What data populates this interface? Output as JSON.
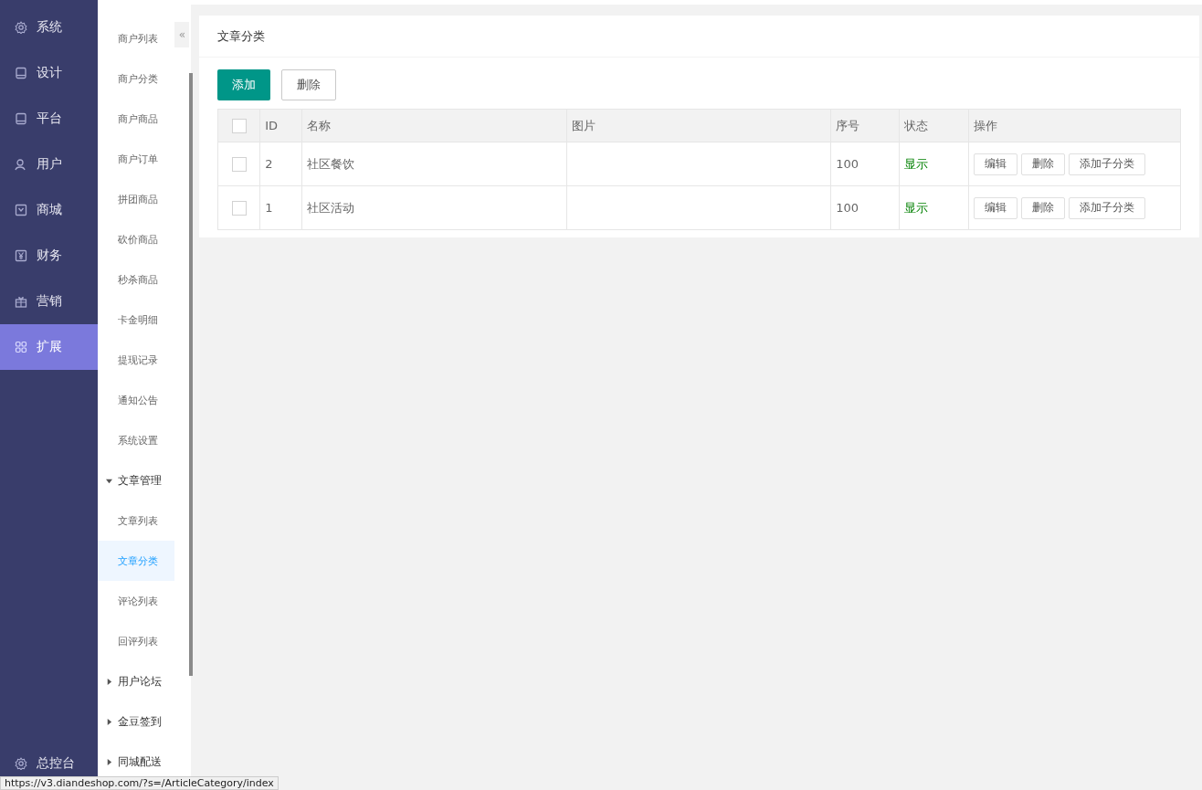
{
  "nav": {
    "items": [
      {
        "label": "系统",
        "kind": "gear",
        "selected": false
      },
      {
        "label": "设计",
        "kind": "tablet",
        "selected": false
      },
      {
        "label": "平台",
        "kind": "tablet",
        "selected": false
      },
      {
        "label": "用户",
        "kind": "users",
        "selected": false
      },
      {
        "label": "商城",
        "kind": "bag",
        "selected": false
      },
      {
        "label": "财务",
        "kind": "yen",
        "selected": false
      },
      {
        "label": "营销",
        "kind": "gift",
        "selected": false
      },
      {
        "label": "扩展",
        "kind": "grid",
        "selected": true
      }
    ],
    "footer": {
      "label": "总控台"
    }
  },
  "submenu": {
    "collapse_icon": "«",
    "items": [
      {
        "kind": "link",
        "label": "商户列表",
        "selected": false
      },
      {
        "kind": "link",
        "label": "商户分类",
        "selected": false
      },
      {
        "kind": "link",
        "label": "商户商品",
        "selected": false
      },
      {
        "kind": "link",
        "label": "商户订单",
        "selected": false
      },
      {
        "kind": "link",
        "label": "拼团商品",
        "selected": false
      },
      {
        "kind": "link",
        "label": "砍价商品",
        "selected": false
      },
      {
        "kind": "link",
        "label": "秒杀商品",
        "selected": false
      },
      {
        "kind": "link",
        "label": "卡金明细",
        "selected": false
      },
      {
        "kind": "link",
        "label": "提现记录",
        "selected": false
      },
      {
        "kind": "link",
        "label": "通知公告",
        "selected": false
      },
      {
        "kind": "link",
        "label": "系统设置",
        "selected": false
      },
      {
        "kind": "group",
        "label": "文章管理",
        "expanded": true,
        "children": [
          {
            "kind": "link",
            "label": "文章列表",
            "selected": false
          },
          {
            "kind": "link",
            "label": "文章分类",
            "selected": true
          },
          {
            "kind": "link",
            "label": "评论列表",
            "selected": false
          },
          {
            "kind": "link",
            "label": "回评列表",
            "selected": false
          }
        ]
      },
      {
        "kind": "group",
        "label": "用户论坛",
        "expanded": false
      },
      {
        "kind": "group",
        "label": "金豆签到",
        "expanded": false
      },
      {
        "kind": "group",
        "label": "同城配送",
        "expanded": false
      }
    ]
  },
  "panel": {
    "title": "文章分类",
    "buttons": [
      {
        "label": "添加",
        "kind": "primary"
      },
      {
        "label": "删除",
        "kind": "plain"
      }
    ],
    "table": {
      "columns": [
        "ID",
        "名称",
        "图片",
        "序号",
        "状态",
        "操作"
      ],
      "header_checked": false,
      "rows": [
        {
          "checked": false,
          "id": "2",
          "name": "社区餐饮",
          "sort": "100",
          "status": "显示",
          "actions": [
            "编辑",
            "删除",
            "添加子分类"
          ]
        },
        {
          "checked": false,
          "id": "1",
          "name": "社区活动",
          "sort": "100",
          "status": "显示",
          "actions": [
            "编辑",
            "删除",
            "添加子分类"
          ]
        }
      ]
    }
  },
  "status_url": "https://v3.diandeshop.com/?s=/ArticleCategory/index"
}
